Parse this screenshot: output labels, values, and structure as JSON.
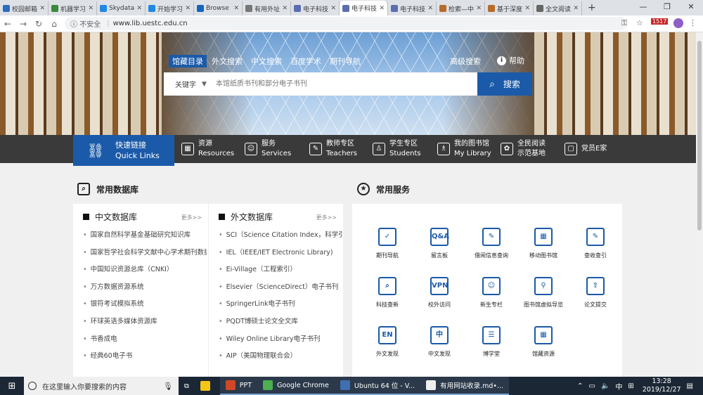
{
  "browser": {
    "tabs": [
      {
        "label": "校园邮箱",
        "color": "#2d6cc0",
        "active": false
      },
      {
        "label": "机器学习",
        "color": "#3a8a3a",
        "active": false
      },
      {
        "label": "Skydata",
        "color": "#1e88e5",
        "active": false
      },
      {
        "label": "开始学习",
        "color": "#1e88e5",
        "active": false
      },
      {
        "label": "Browse",
        "color": "#1565c0",
        "active": false
      },
      {
        "label": "有用外址",
        "color": "#777777",
        "active": false
      },
      {
        "label": "电子科技",
        "color": "#5a6fb0",
        "active": false
      },
      {
        "label": "电子科技",
        "color": "#5a6fb0",
        "active": true
      },
      {
        "label": "电子科技",
        "color": "#5a6fb0",
        "active": false
      },
      {
        "label": "检索—中",
        "color": "#b86b2a",
        "active": false
      },
      {
        "label": "基于深度",
        "color": "#b86b2a",
        "active": false
      },
      {
        "label": "全文阅读",
        "color": "#666666",
        "active": false
      }
    ],
    "url_security": "不安全",
    "url": "www.lib.uestc.edu.cn",
    "badge": "1517"
  },
  "search": {
    "tabs": [
      {
        "label": "馆藏目录",
        "active": true
      },
      {
        "label": "外文搜索",
        "active": false
      },
      {
        "label": "中文搜索",
        "active": false
      },
      {
        "label": "百度学术",
        "active": false
      },
      {
        "label": "期刊导航",
        "active": false
      }
    ],
    "advanced": "高级搜索",
    "help": "帮助",
    "keytype": "关键字",
    "placeholder": "本馆纸质书刊和部分电子书刊",
    "button": "搜索"
  },
  "nav": {
    "quick": {
      "cn": "快速链接",
      "en": "Quick Links"
    },
    "items": [
      {
        "cn": "资源",
        "en": "Resources",
        "icon": "resources-icon"
      },
      {
        "cn": "服务",
        "en": "Services",
        "icon": "services-icon"
      },
      {
        "cn": "教师专区",
        "en": "Teachers",
        "icon": "teachers-icon"
      },
      {
        "cn": "学生专区",
        "en": "Students",
        "icon": "students-icon"
      },
      {
        "cn": "我的图书馆",
        "en": "My Library",
        "icon": "my-library-icon"
      },
      {
        "cn": "全民阅读",
        "en": "示范基地",
        "icon": "reading-icon"
      },
      {
        "cn": "党员E家",
        "en": "",
        "icon": "party-icon"
      }
    ]
  },
  "databases": {
    "title": "常用数据库",
    "chinese": {
      "heading": "中文数据库",
      "more": "更多>>",
      "items": [
        "国家自然科学基金基础研究知识库",
        "国家哲学社会科学文献中心学术期刊数据",
        "中国知识资源总库（CNKI）",
        "万方数据资源系统",
        "银符考试模拟系统",
        "环球英语多媒体资源库",
        "书香成电",
        "经典60电子书"
      ]
    },
    "foreign": {
      "heading": "外文数据库",
      "more": "更多>>",
      "items": [
        "SCI（Science Citation Index，科学引文",
        "IEL（IEEE/IET Electronic Library)",
        "Ei-Village（工程索引）",
        "Elsevier（ScienceDirect）电子书刊",
        "SpringerLink电子书刊",
        "PQDT博硕士论文全文库",
        "Wiley Online Library电子书刊",
        "AIP（美国物理联合会）"
      ]
    }
  },
  "services": {
    "title": "常用服务",
    "items": [
      {
        "label": "期刊导航",
        "icon": "journal-nav-icon",
        "glyph": "✓"
      },
      {
        "label": "留言板",
        "icon": "message-board-icon",
        "glyph": "Q&A"
      },
      {
        "label": "借阅信息查询",
        "icon": "loan-query-icon",
        "glyph": "✎"
      },
      {
        "label": "移动图书馆",
        "icon": "mobile-library-icon",
        "glyph": "▦"
      },
      {
        "label": "查收查引",
        "icon": "citation-check-icon",
        "glyph": "✎"
      },
      {
        "label": "科技查新",
        "icon": "novelty-search-icon",
        "glyph": "⌕"
      },
      {
        "label": "校外访问",
        "icon": "vpn-icon",
        "glyph": "VPN"
      },
      {
        "label": "新生专栏",
        "icon": "freshman-icon",
        "glyph": "☺"
      },
      {
        "label": "图书馆虚拟导览",
        "icon": "virtual-tour-icon",
        "glyph": "⚲"
      },
      {
        "label": "论文提交",
        "icon": "thesis-submit-icon",
        "glyph": "⇧"
      },
      {
        "label": "外文发现",
        "icon": "foreign-discovery-icon",
        "glyph": "EN"
      },
      {
        "label": "中文发现",
        "icon": "chinese-discovery-icon",
        "glyph": "中"
      },
      {
        "label": "博学堂",
        "icon": "lecture-icon",
        "glyph": "☰"
      },
      {
        "label": "馆藏资源",
        "icon": "collection-icon",
        "glyph": "▦"
      }
    ]
  },
  "taskbar": {
    "search_placeholder": "在这里输入你要搜索的内容",
    "apps": [
      {
        "label": "PPT",
        "color": "#d24726",
        "open": true
      },
      {
        "label": "Google Chrome",
        "color": "#4caf50",
        "open": true
      },
      {
        "label": "Ubuntu 64 位 - V...",
        "color": "#3f6fb0",
        "open": true
      },
      {
        "label": "有用网站收录.md•...",
        "color": "#eeeeee",
        "open": true
      }
    ],
    "ime": "中",
    "time": "13:28",
    "date": "2019/12/27"
  }
}
